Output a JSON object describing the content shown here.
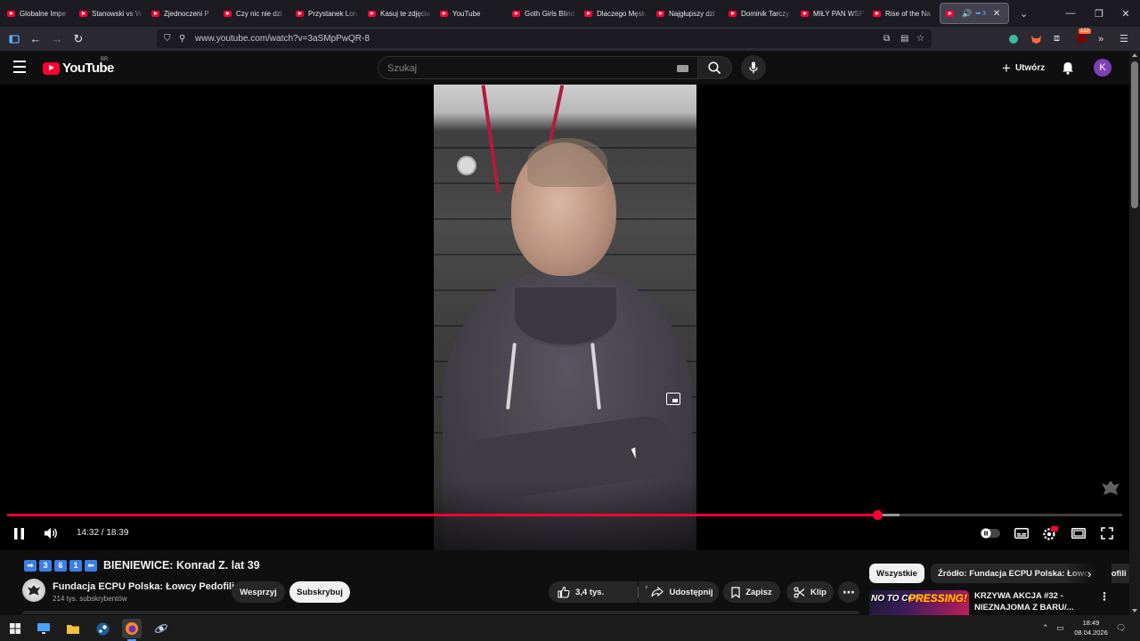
{
  "browser": {
    "tabs": [
      {
        "title": "Globalne Impe"
      },
      {
        "title": "Stanowski vs W"
      },
      {
        "title": "Zjednoczeni P"
      },
      {
        "title": "Czy nic nie dzi"
      },
      {
        "title": "Przystanek Lon"
      },
      {
        "title": "Kasuj te zdjęcia"
      },
      {
        "title": "YouTube"
      },
      {
        "title": "Goth Girls Blind"
      },
      {
        "title": "Dlaczego Męsk"
      },
      {
        "title": "Najgłupszy dzi"
      },
      {
        "title": "Dominik Tarczy"
      },
      {
        "title": "MIŁY PAN WSP"
      },
      {
        "title": "Rise of the Na"
      }
    ],
    "active_tab_badges": "➡ 3",
    "url": "www.youtube.com/watch?v=3aSMpPwQR-8",
    "extension_badge": "122"
  },
  "youtube": {
    "logo_text": "YouTube",
    "region": "BR",
    "search_placeholder": "Szukaj",
    "create_label": "Utwórz",
    "avatar_letter": "K"
  },
  "player": {
    "current_time": "14:32",
    "duration": "18:39",
    "time_display": "14:32 / 18:39",
    "progress_fraction": 0.78,
    "buffer_fraction": 0.8
  },
  "video": {
    "title_badges": [
      "➡",
      "3",
      "6",
      "1",
      "⬅"
    ],
    "title": "BIENIEWICE: Konrad Z. lat 39",
    "channel_name": "Fundacja ECPU Polska: Łowcy Pedofili",
    "subscribers": "214 tys. subskrybentów",
    "support_label": "Wesprzyj",
    "subscribe_label": "Subskrybuj",
    "likes": "3,4 tys.",
    "share_label": "Udostępnij",
    "save_label": "Zapisz",
    "clip_label": "Klip"
  },
  "sidebar": {
    "chips": [
      "Wszystkie",
      "Źródło: Fundacja ECPU Polska: Łowcy Pedofili"
    ],
    "recommendation": {
      "thumb_text_1": "NO TO CO?",
      "thumb_text_2": "PRESSING!",
      "title": "KRZYWA AKCJA #32 - NIEZNAJOMA Z BARU/..."
    }
  },
  "taskbar": {
    "time": "18:49",
    "date": "08.04.2026"
  },
  "colors": {
    "accent_red": "#ff0033",
    "badge_blue": "#3b7ee6",
    "avatar_purple": "#7e3fb5"
  }
}
